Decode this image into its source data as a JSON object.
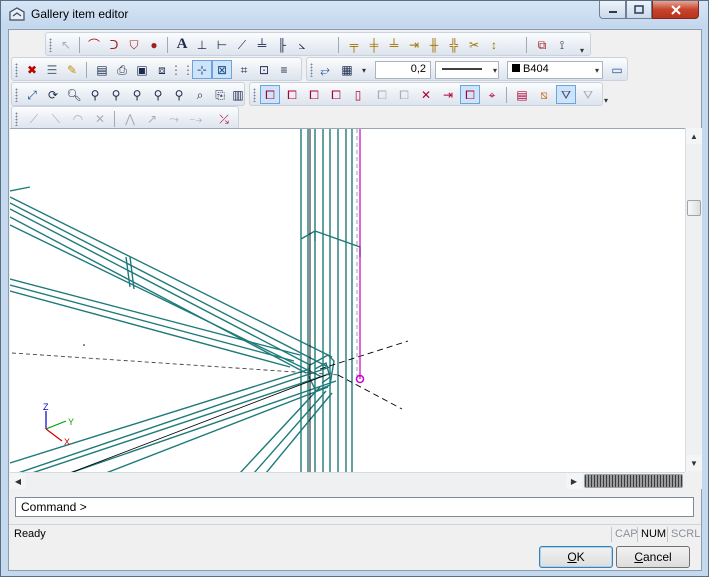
{
  "window": {
    "title": "Gallery item editor"
  },
  "icons": {
    "toolbar1": [
      "cursor-arrow-icon",
      "arc-icon",
      "polyline-icon",
      "shape-icon",
      "circle-icon",
      "text-icon",
      "dimension-horizontal-icon",
      "dimension-vertical-icon",
      "dimension-aligned-icon",
      "dimension-baseline-icon",
      "dimension-ordinate-icon",
      "dimension-angle-icon",
      "align-top-icon",
      "align-center-icon",
      "align-bottom-icon",
      "distribute-icon",
      "split-icon",
      "join-icon",
      "trim-icon",
      "extend-icon",
      "group-icon",
      "measure-icon"
    ],
    "toolbar2": [
      "delete-icon",
      "layer-icon",
      "pen-icon",
      "properties-icon",
      "print-preview-icon",
      "save-icon",
      "save-all-icon",
      "grid-icon",
      "snap-icon",
      "snap-grid-icon",
      "frame-icon",
      "frame-fit-icon",
      "align-icon",
      "line-style-icon",
      "color-palette-icon",
      "layout-icon"
    ],
    "toolbar3": [
      "move-icon",
      "rotate-3d-icon",
      "zoom-in-icon",
      "zoom-out-icon",
      "zoom-window-icon",
      "zoom-extents-icon",
      "zoom-previous-icon",
      "pan-icon",
      "zoom-selection-icon",
      "redraw-icon",
      "select-all-icon",
      "select-window-icon",
      "select-cross-icon",
      "select-filter-icon",
      "select-invert-icon",
      "select-layer-icon",
      "select-type-icon",
      "deselect-icon",
      "select-previous-icon",
      "select-highlight-icon",
      "select-point-icon",
      "filter-on-icon",
      "filter-edit-icon",
      "filter-off-icon"
    ],
    "toolbar4": [
      "line-icon",
      "line-2-icon",
      "arc-3pt-icon",
      "cross-icon",
      "polyline-2-icon",
      "curve-icon",
      "spline-icon",
      "wave-icon",
      "snap-delete-icon"
    ]
  },
  "toolbar": {
    "line_width_value": "0,2",
    "color_value": "B404",
    "color_swatch": "#000000"
  },
  "viewport": {
    "axis_z": "Z",
    "axis_y": "Y",
    "axis_x": "X"
  },
  "command": {
    "label": "Command >"
  },
  "status": {
    "text": "Ready",
    "cap": "CAP",
    "num": "NUM",
    "scrl": "SCRL"
  },
  "buttons": {
    "ok_label": "OK",
    "ok_mnemonic": "O",
    "ok_rest": "K",
    "cancel_label": "Cancel",
    "cancel_mnemonic": "C",
    "cancel_rest": "ancel"
  },
  "colors": {
    "structure": "#1f7a7a",
    "highlight": "#cc00cc",
    "axis_x": "#cc0000",
    "axis_y": "#00a000",
    "axis_z": "#0000cc"
  }
}
